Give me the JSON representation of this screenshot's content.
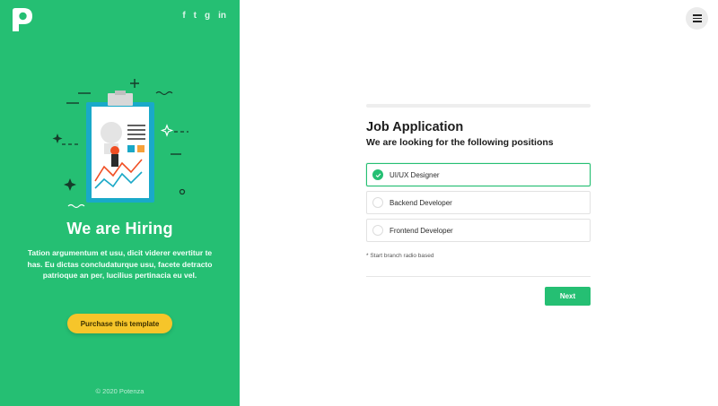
{
  "brand": {
    "logo_icon": "p-logo-icon",
    "accent": "#25bf73",
    "button_yellow": "#f6c52a"
  },
  "social": [
    {
      "icon": "facebook-icon",
      "glyph": "f"
    },
    {
      "icon": "twitter-icon",
      "glyph": "t"
    },
    {
      "icon": "google-plus-icon",
      "glyph": "g"
    },
    {
      "icon": "linkedin-icon",
      "glyph": "in"
    }
  ],
  "hero": {
    "title": "We are Hiring",
    "text": "Tation argumentum et usu, dicit viderer evertitur te has. Eu dictas concludaturque usu, facete detracto patrioque an per, lucilius pertinacia eu vel.",
    "cta_label": "Purchase this template",
    "copyright": "© 2020 Potenza"
  },
  "header": {
    "menu_icon": "hamburger-menu-icon"
  },
  "form": {
    "progress": 0,
    "title": "Job Application",
    "subtitle": "We are looking for the following positions",
    "options": [
      {
        "label": "UI/UX Designer",
        "selected": true
      },
      {
        "label": "Backend Developer",
        "selected": false
      },
      {
        "label": "Frontend Developer",
        "selected": false
      }
    ],
    "note": "* Start branch radio based",
    "next_label": "Next"
  }
}
